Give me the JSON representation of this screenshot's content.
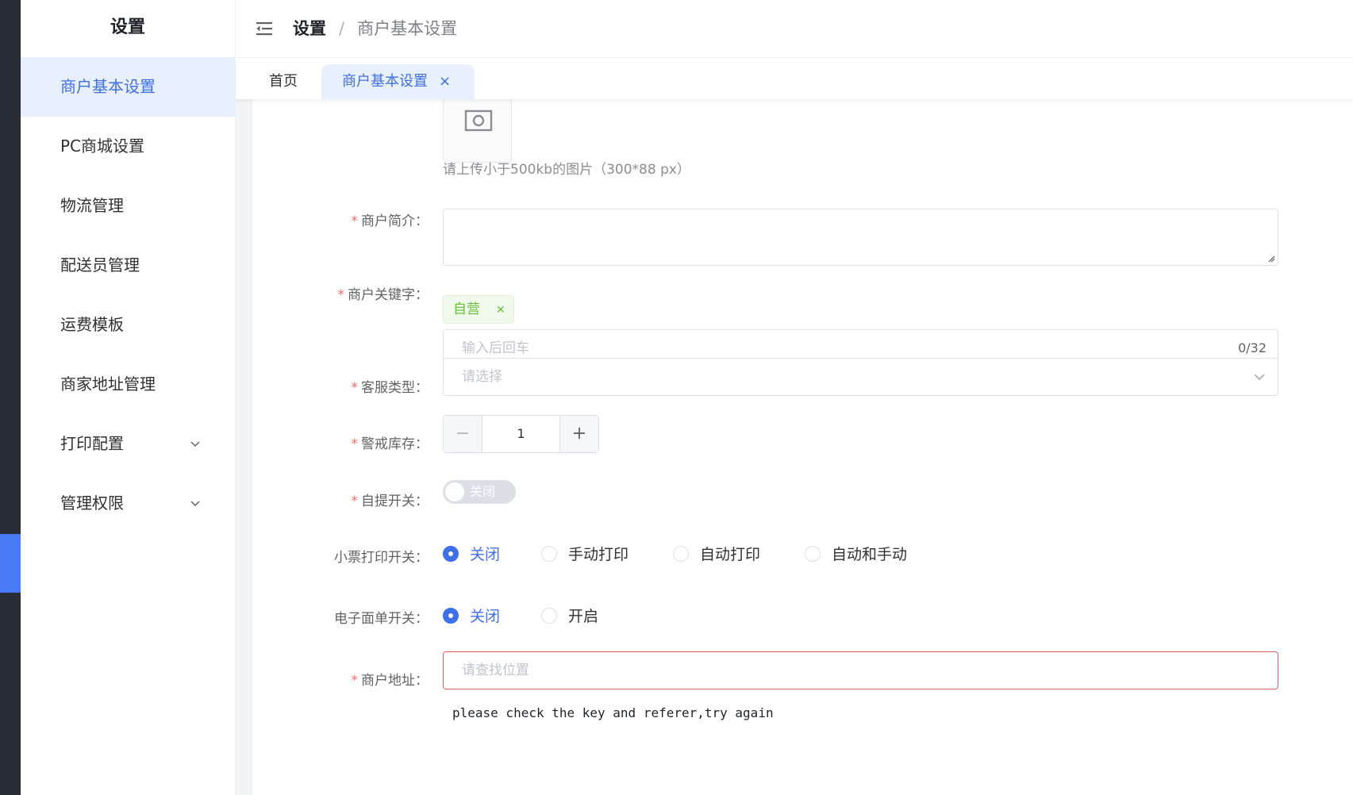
{
  "sidebar": {
    "title": "设置",
    "items": [
      {
        "label": "商户基本设置"
      },
      {
        "label": "PC商城设置"
      },
      {
        "label": "物流管理"
      },
      {
        "label": "配送员管理"
      },
      {
        "label": "运费模板"
      },
      {
        "label": "商家地址管理"
      },
      {
        "label": "打印配置"
      },
      {
        "label": "管理权限"
      }
    ]
  },
  "header": {
    "breadcrumb_root": "设置",
    "breadcrumb_sep": "/",
    "breadcrumb_current": "商户基本设置"
  },
  "tabs": {
    "home": "首页",
    "current": "商户基本设置",
    "close_glyph": "×"
  },
  "form": {
    "upload_hint": "请上传小于500kb的图片（300*88 px）",
    "intro_label": "商户简介：",
    "keywords_label": "商户关键字：",
    "keyword_tag": "自营",
    "keyword_input_placeholder": "输入后回车",
    "keyword_count": "0/32",
    "service_type_label": "客服类型：",
    "service_type_placeholder": "请选择",
    "stock_alert_label": "警戒库存：",
    "stock_alert_value": "1",
    "pickup_label": "自提开关：",
    "pickup_switch_text": "关闭",
    "receipt_print_label": "小票打印开关：",
    "receipt_print_options": [
      "关闭",
      "手动打印",
      "自动打印",
      "自动和手动"
    ],
    "eorder_label": "电子面单开关：",
    "eorder_options": [
      "关闭",
      "开启"
    ],
    "address_label": "商户地址：",
    "address_placeholder": "请查找位置",
    "map_error": "please check the key and referer,try again"
  }
}
